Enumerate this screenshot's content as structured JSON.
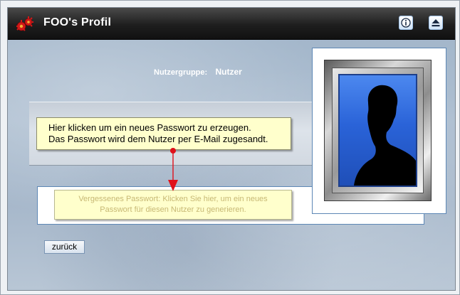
{
  "window": {
    "title": "FOO's Profil"
  },
  "profile": {
    "group_label": "Nutzergruppe:",
    "group_value": "Nutzer"
  },
  "tooltip_main": {
    "line1": "Hier klicken um ein neues Passwort zu erzeugen.",
    "line2": "Das Passwort wird dem Nutzer per E-Mail zugesandt."
  },
  "tooltip_hint": {
    "line1": "Vergessenes Passwort: Klicken Sie hier, um ein neues",
    "line2": "Passwort für diesen Nutzer zu generieren."
  },
  "buttons": {
    "back_label": "zurück"
  },
  "icons": {
    "logo": "gear-bug-logo-icon",
    "info": "info-icon",
    "eject": "eject-icon"
  },
  "colors": {
    "accent": "#5d87b5",
    "tooltip_bg": "#ffffcc",
    "arrow": "#e0101a"
  }
}
